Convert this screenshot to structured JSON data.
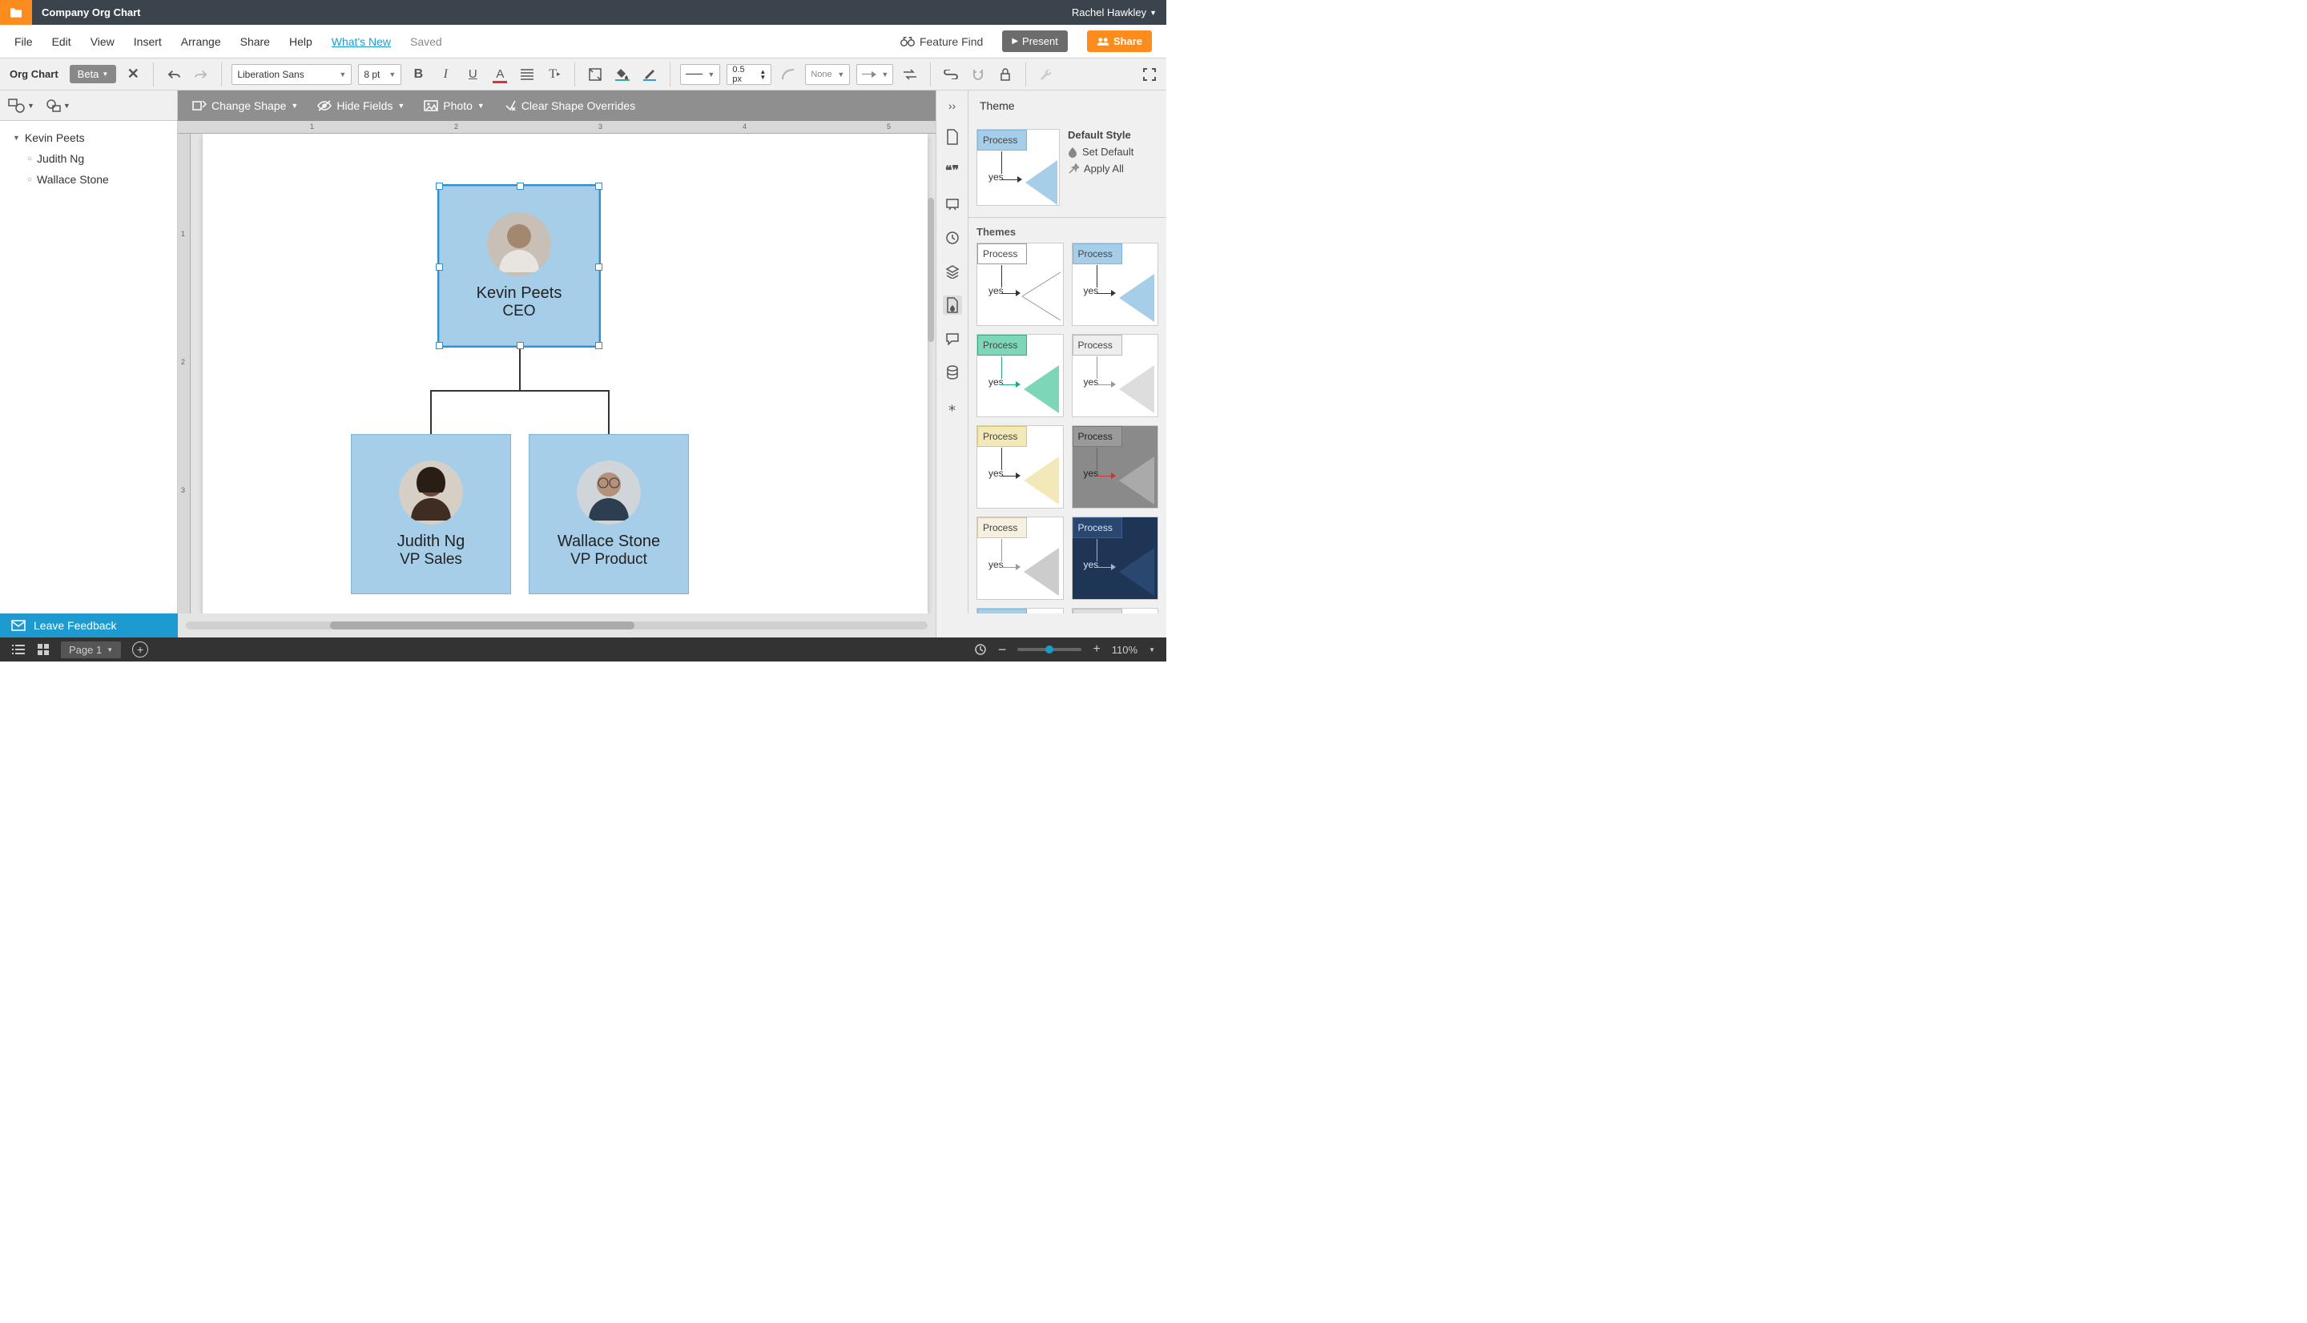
{
  "topbar": {
    "doc_title": "Company Org Chart",
    "user_name": "Rachel Hawkley"
  },
  "menubar": {
    "file": "File",
    "edit": "Edit",
    "view": "View",
    "insert": "Insert",
    "arrange": "Arrange",
    "share": "Share",
    "help": "Help",
    "whatsnew": "What's New",
    "saved": "Saved",
    "feature_find": "Feature Find",
    "present": "Present",
    "share_btn": "Share"
  },
  "toolbar": {
    "section": "Org Chart",
    "beta": "Beta",
    "font": "Liberation Sans",
    "font_size": "8 pt",
    "line_width": "0.5 px",
    "line_end": "None"
  },
  "toolbar2": {
    "change_shape": "Change Shape",
    "hide_fields": "Hide Fields",
    "photo": "Photo",
    "clear_overrides": "Clear Shape Overrides"
  },
  "outline": {
    "root": "Kevin Peets",
    "children": [
      "Judith Ng",
      "Wallace Stone"
    ]
  },
  "nodes": {
    "ceo": {
      "name": "Kevin Peets",
      "title": "CEO"
    },
    "vp1": {
      "name": "Judith Ng",
      "title": "VP Sales"
    },
    "vp2": {
      "name": "Wallace Stone",
      "title": "VP Product"
    }
  },
  "right_panel": {
    "header": "Theme",
    "default_style": "Default Style",
    "set_default": "Set Default",
    "apply_all": "Apply All",
    "themes_label": "Themes",
    "process": "Process",
    "yes": "yes"
  },
  "feedback": "Leave Feedback",
  "status": {
    "page": "Page 1",
    "zoom": "110%"
  },
  "ruler": {
    "h": [
      "1",
      "2",
      "3",
      "4",
      "5"
    ],
    "v": [
      "1",
      "2",
      "3"
    ]
  }
}
